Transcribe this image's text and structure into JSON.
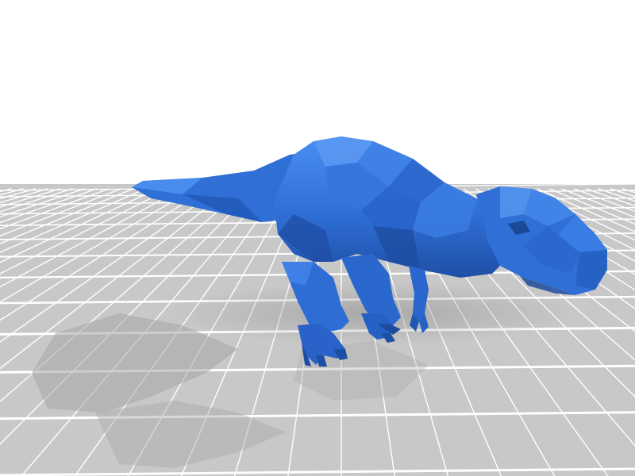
{
  "scene": {
    "subject": "low-poly-dinosaur-model",
    "colors": {
      "background": "#ffffff",
      "plate": "#c9c9c9",
      "plate_far": "#e6e6e6",
      "grid_line": "#ffffff",
      "model_base": "#2f6fd6",
      "model_light": "#4b8ff0",
      "model_dark": "#1f4fa8",
      "shadow": "#9a9a9a"
    }
  }
}
